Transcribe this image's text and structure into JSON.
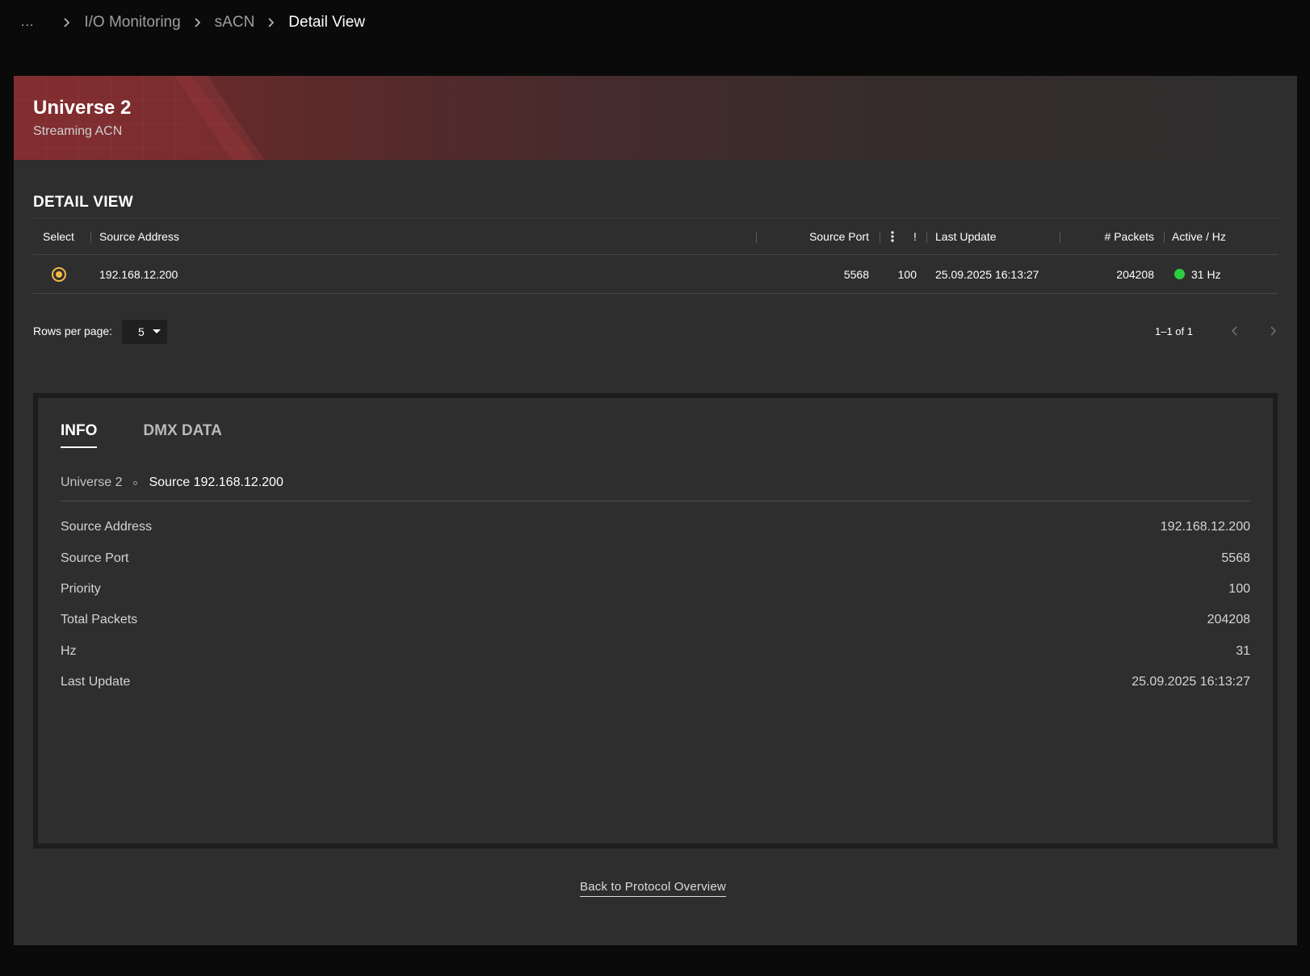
{
  "breadcrumb": {
    "more": "...",
    "items": [
      "I/O Monitoring",
      "sACN"
    ],
    "current": "Detail View"
  },
  "banner": {
    "title": "Universe 2",
    "subtitle": "Streaming ACN"
  },
  "section": {
    "title": "DETAIL VIEW"
  },
  "table": {
    "headers": {
      "select": "Select",
      "source_address": "Source Address",
      "source_port": "Source Port",
      "priority": "!",
      "last_update": "Last Update",
      "packets": "# Packets",
      "active_hz": "Active / Hz"
    },
    "rows": [
      {
        "selected": true,
        "source_address": "192.168.12.200",
        "source_port": "5568",
        "priority": "100",
        "last_update": "25.09.2025 16:13:27",
        "packets": "204208",
        "hz": "31 Hz",
        "status_color": "#2ecc40"
      }
    ]
  },
  "pagination": {
    "rows_per_page_label": "Rows per page:",
    "rows_per_page": "5",
    "range": "1–1 of 1"
  },
  "info": {
    "tabs": [
      "INFO",
      "DMX DATA"
    ],
    "active_tab": "INFO",
    "sub_crumb": {
      "universe": "Universe 2",
      "source": "Source 192.168.12.200"
    },
    "rows": [
      {
        "label": "Source Address",
        "value": "192.168.12.200"
      },
      {
        "label": "Source Port",
        "value": "5568"
      },
      {
        "label": "Priority",
        "value": "100"
      },
      {
        "label": "Total Packets",
        "value": "204208"
      },
      {
        "label": "Hz",
        "value": "31"
      },
      {
        "label": "Last Update",
        "value": "25.09.2025 16:13:27"
      }
    ]
  },
  "footer": {
    "back_link": "Back to Protocol Overview"
  },
  "colors": {
    "accent_radio": "#f5b942",
    "status_active": "#2ecc40",
    "banner_red": "#7a2b2d"
  }
}
